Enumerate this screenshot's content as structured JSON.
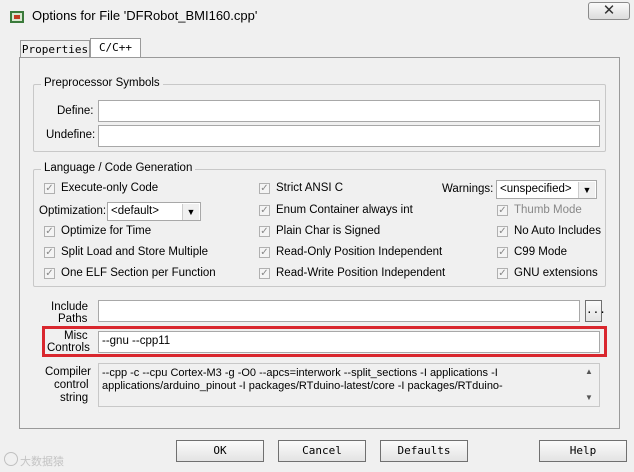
{
  "window": {
    "title": "Options for File 'DFRobot_BMI160.cpp'",
    "close_glyph": "✕"
  },
  "tabs": [
    {
      "label": "Properties"
    },
    {
      "label": "C/C++"
    }
  ],
  "preprocessor": {
    "legend": "Preprocessor Symbols",
    "define_label": "Define:",
    "define_value": "",
    "undefine_label": "Undefine:",
    "undefine_value": ""
  },
  "language": {
    "legend": "Language / Code Generation",
    "checks": [
      {
        "label": "Execute-only Code",
        "checked": true
      },
      {
        "label": "Strict ANSI C",
        "checked": true
      },
      {
        "label": "Enum Container always int",
        "checked": true
      },
      {
        "label": "Plain Char is Signed",
        "checked": true
      },
      {
        "label": "Read-Only Position Independent",
        "checked": true
      },
      {
        "label": "Read-Write Position Independent",
        "checked": true
      },
      {
        "label": "Optimize for Time",
        "checked": true
      },
      {
        "label": "Split Load and Store Multiple",
        "checked": true
      },
      {
        "label": "One ELF Section per Function",
        "checked": true
      },
      {
        "label": "Thumb Mode",
        "checked": true,
        "disabled": true
      },
      {
        "label": "No Auto Includes",
        "checked": true
      },
      {
        "label": "C99 Mode",
        "checked": true
      },
      {
        "label": "GNU extensions",
        "checked": true
      }
    ],
    "optimization_label": "Optimization:",
    "optimization_value": "<default>",
    "warnings_label": "Warnings:",
    "warnings_value": "<unspecified>"
  },
  "include_paths": {
    "label1": "Include",
    "label2": "Paths",
    "value": "",
    "browse": "..."
  },
  "misc_controls": {
    "label1": "Misc",
    "label2": "Controls",
    "value": "--gnu --cpp11"
  },
  "compiler_control": {
    "label1": "Compiler",
    "label2": "control",
    "label3": "string",
    "line1": "--cpp -c --cpu Cortex-M3 -g -O0 --apcs=interwork --split_sections -I applications -I",
    "line2": "applications/arduino_pinout -I packages/RTduino-latest/core -I packages/RTduino-"
  },
  "buttons": {
    "ok": "OK",
    "cancel": "Cancel",
    "defaults": "Defaults",
    "help": "Help"
  },
  "watermark": "大数据猿"
}
